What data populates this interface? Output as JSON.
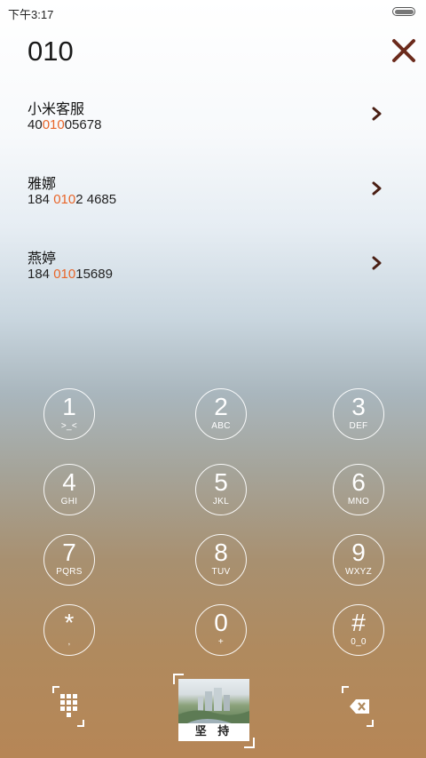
{
  "status": {
    "time": "下午3:17"
  },
  "dialer": {
    "number": "010"
  },
  "contacts": [
    {
      "name": "小米客服",
      "num_pre": "40",
      "num_hl": "010",
      "num_post": "05678"
    },
    {
      "name": "雅娜",
      "num_pre": "184 ",
      "num_hl": "010",
      "num_post": "2 4685"
    },
    {
      "name": "燕婷",
      "num_pre": "184 ",
      "num_hl": "010",
      "num_post": "15689"
    }
  ],
  "keys": [
    {
      "digit": "1",
      "sub": ">_<"
    },
    {
      "digit": "2",
      "sub": "ABC"
    },
    {
      "digit": "3",
      "sub": "DEF"
    },
    {
      "digit": "4",
      "sub": "GHI"
    },
    {
      "digit": "5",
      "sub": "JKL"
    },
    {
      "digit": "6",
      "sub": "MNO"
    },
    {
      "digit": "7",
      "sub": "PQRS"
    },
    {
      "digit": "8",
      "sub": "TUV"
    },
    {
      "digit": "9",
      "sub": "WXYZ"
    },
    {
      "digit": "*",
      "sub": ","
    },
    {
      "digit": "0",
      "sub": "+"
    },
    {
      "digit": "#",
      "sub": "0_0"
    }
  ],
  "bottom": {
    "thumbnail_caption": "坚 持"
  },
  "colors": {
    "highlight": "#e8662a",
    "close": "#6b2a1c"
  },
  "icons": {
    "close": "close-icon",
    "arrow": "chevron-right-icon",
    "keypad": "keypad-grid-icon",
    "delete": "backspace-icon"
  }
}
